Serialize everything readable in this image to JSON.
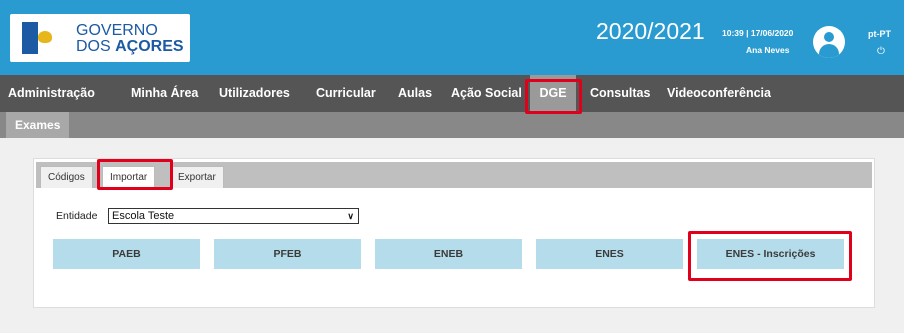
{
  "header": {
    "logo_line1": "GOVERNO",
    "logo_line2_prefix": "DOS ",
    "logo_line2_bold": "AÇORES",
    "year": "2020/2021",
    "datetime": "10:39 | 17/06/2020",
    "username": "Ana Neves",
    "language": "pt-PT",
    "power_icon": "power-icon",
    "avatar_icon": "user-avatar-icon"
  },
  "nav": {
    "items": [
      "Administração",
      "Minha Área",
      "Utilizadores",
      "Curricular",
      "Aulas",
      "Ação Social",
      "DGE",
      "Consultas",
      "Videoconferência"
    ],
    "active": "DGE"
  },
  "subnav": {
    "items": [
      "Exames"
    ]
  },
  "tabs": {
    "items": [
      "Códigos",
      "Importar",
      "Exportar"
    ],
    "active": "Importar"
  },
  "form": {
    "entidade_label": "Entidade",
    "entidade_value": "Escola Teste"
  },
  "buttons": [
    "PAEB",
    "PFEB",
    "ENEB",
    "ENES",
    "ENES - Inscrições"
  ],
  "colors": {
    "header_bg": "#2a9bd1",
    "nav_bg": "#555555",
    "button_bg": "#b5dcea",
    "highlight": "#e0001b"
  }
}
